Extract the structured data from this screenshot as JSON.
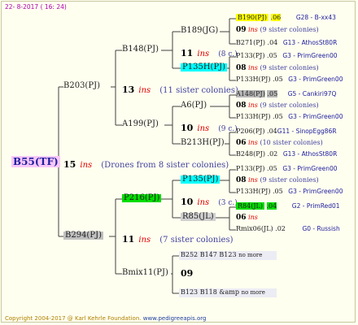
{
  "header": {
    "date": "22-  8-2017 ( 16: 24)"
  },
  "footer": {
    "copyright": "Copyright 2004-2017 @ Karl Kehrle Foundation.",
    "site": "www.pedigreeapis.org"
  },
  "root": {
    "id": "B55(TF)",
    "gen": "15",
    "ins": "ins",
    "note": "(Drones from 8 sister colonies)"
  },
  "sire": {
    "id": "B203(PJ)",
    "gen": "13",
    "ins": "ins",
    "note": "(11 sister colonies)"
  },
  "dam": {
    "id": "B294(PJ)",
    "gen": "11",
    "ins": "ins",
    "note": "(7 sister colonies)"
  },
  "b148": {
    "id": "B148(PJ)",
    "gen": "11",
    "ins": "ins",
    "note": "(8 c.)"
  },
  "a199": {
    "id": "A199(PJ)"
  },
  "p216": {
    "id": "P216(PJ)"
  },
  "bmix": {
    "id": "Bmix11(PJ)",
    "gen": "09"
  },
  "b189": {
    "id": "B189(JG)"
  },
  "p135h_1": {
    "id": "P135H(PJ)"
  },
  "a6": {
    "id": "A6(PJ)",
    "gen": "10",
    "ins": "ins",
    "note": "(9 c.)"
  },
  "b213h": {
    "id": "B213H(PJ)"
  },
  "p135": {
    "id": "P135(PJ)",
    "gen": "10",
    "ins": "ins",
    "note": "(3 c.)"
  },
  "r85": {
    "id": "R85(JL)"
  },
  "b252": {
    "id": "B252",
    "extra": "B147",
    "extra2": "B123",
    "nomore": "no more"
  },
  "b123": {
    "id": "B123",
    "extra": "B118",
    "extra2": "&amp",
    "nomore": "no more"
  },
  "leaves": [
    {
      "id": "B190(PJ)",
      "val": ".06",
      "info": "G28 - B-xx43"
    },
    {
      "gen": "09",
      "ins": "ins",
      "note": "(9 sister colonies)"
    },
    {
      "id": "B271(PJ)",
      "val": ".04",
      "info": "G13 - AthosSt80R"
    },
    {
      "id": "P133(PJ)",
      "val": ".05",
      "info": "G3 - PrimGreen00"
    },
    {
      "gen": "08",
      "ins": "ins",
      "note": "(9 sister colonies)"
    },
    {
      "id": "P133H(PJ)",
      "val": ".05",
      "info": "G3 - PrimGreen00"
    },
    {
      "id": "A148(PJ)",
      "val": ".05",
      "info": "G5 - Cankiri97Q"
    },
    {
      "gen": "08",
      "ins": "ins",
      "note": "(9 sister colonies)"
    },
    {
      "id": "P133H(PJ)",
      "val": ".05",
      "info": "G3 - PrimGreen00"
    },
    {
      "id": "P206(PJ)",
      "val": ".04",
      "info": "G11 - SinopEgg86R"
    },
    {
      "gen": "06",
      "ins": "ins",
      "note": "(10 sister colonies)"
    },
    {
      "id": "B248(PJ)",
      "val": ".02",
      "info": "G13 - AthosSt80R"
    },
    {
      "id": "P133(PJ)",
      "val": ".05",
      "info": "G3 - PrimGreen00"
    },
    {
      "gen": "08",
      "ins": "ins",
      "note": "(9 sister colonies)"
    },
    {
      "id": "P133H(PJ)",
      "val": ".05",
      "info": "G3 - PrimGreen00"
    },
    {
      "id": "R84(JL)",
      "val": ".04",
      "info": "G2 - PrimRed01"
    },
    {
      "gen": "06",
      "ins": "ins",
      "note": ""
    },
    {
      "id": "Rmix06(JL)",
      "val": ".02",
      "info": "G0 - Russish"
    }
  ]
}
